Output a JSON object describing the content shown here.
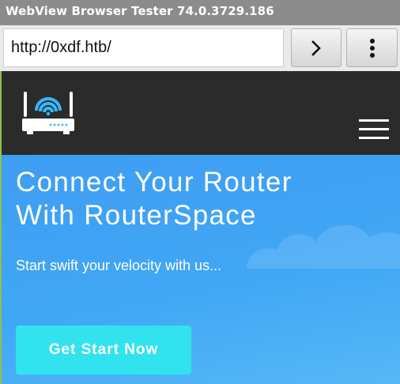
{
  "app": {
    "title": "WebView Browser Tester 74.0.3729.186"
  },
  "toolbar": {
    "url_value": "http://0xdf.htb/",
    "go_button_icon": "chevron-right-icon",
    "menu_button_icon": "overflow-menu-icon"
  },
  "site": {
    "logo_icon": "wifi-router-icon",
    "menu_icon": "hamburger-menu-icon",
    "hero": {
      "title_line1": "Connect Your Router",
      "title_line2": "With RouterSpace",
      "subtitle": "Start swift your velocity with us...",
      "cta_label": "Get Start Now"
    }
  },
  "colors": {
    "titlebar_bg": "#8c8c8c",
    "header_bg": "#2b2b2b",
    "hero_bg": "#41a7f5",
    "cta_bg": "#32e3ef",
    "webview_border": "#8bc34a"
  }
}
